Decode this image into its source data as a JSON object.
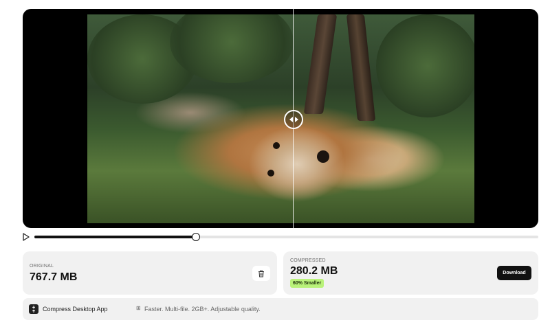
{
  "player": {
    "progress": 0.32
  },
  "original": {
    "caption": "ORIGINAL",
    "size": "767.7 MB"
  },
  "compressed": {
    "caption": "COMPRESSED",
    "size": "280.2 MB",
    "badge": "60% Smaller",
    "download_label": "Download"
  },
  "promo": {
    "title": "Compress Desktop App",
    "apple_glyph": "",
    "windows_glyph": "⊞",
    "description": "Faster. Multi-file. 2GB+. Adjustable quality."
  },
  "colors": {
    "badge_bg": "#b9f27a",
    "button_bg": "#111111"
  }
}
